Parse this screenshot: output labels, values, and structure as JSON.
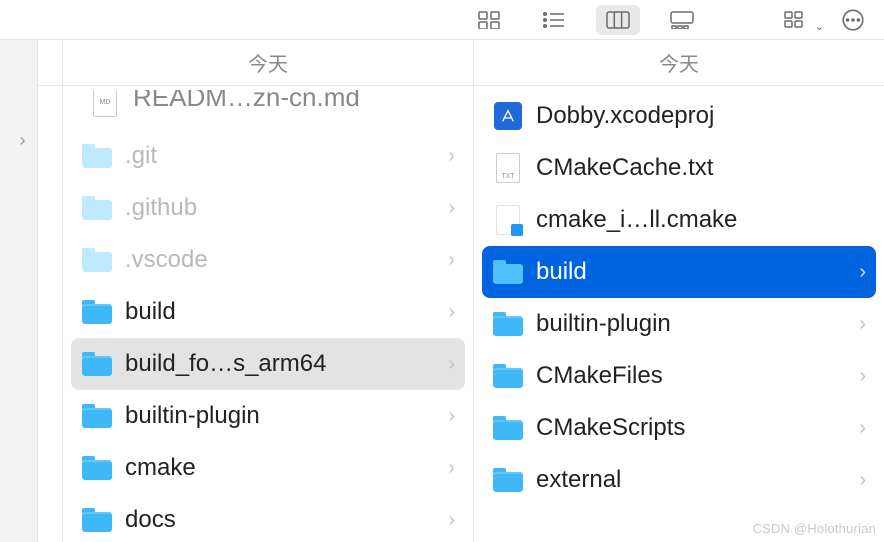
{
  "toolbar": {
    "icon_view": "grid-icon",
    "list_view": "list-icon",
    "column_view": "column-icon",
    "gallery_view": "gallery-icon",
    "group_view": "group-icon",
    "action_view": "action-icon"
  },
  "col1": {
    "header": ""
  },
  "col2": {
    "header": "今天",
    "partial_item": {
      "name": "READM…zn-cn.md",
      "icon": "md-file"
    },
    "items": [
      {
        "name": ".git",
        "icon": "folder-light",
        "has_children": true,
        "dim": true
      },
      {
        "name": ".github",
        "icon": "folder-light",
        "has_children": true,
        "dim": true
      },
      {
        "name": ".vscode",
        "icon": "folder-light",
        "has_children": true,
        "dim": true
      },
      {
        "name": "build",
        "icon": "folder-blue",
        "has_children": true
      },
      {
        "name": "build_fo…s_arm64",
        "icon": "folder-blue",
        "has_children": true,
        "selected": "grey"
      },
      {
        "name": "builtin-plugin",
        "icon": "folder-blue",
        "has_children": true
      },
      {
        "name": "cmake",
        "icon": "folder-blue",
        "has_children": true
      },
      {
        "name": "docs",
        "icon": "folder-blue",
        "has_children": true
      }
    ]
  },
  "col3": {
    "header": "今天",
    "items": [
      {
        "name": "Dobby.xcodeproj",
        "icon": "xcode"
      },
      {
        "name": "CMakeCache.txt",
        "icon": "txt"
      },
      {
        "name": "cmake_i…ll.cmake",
        "icon": "cmake"
      },
      {
        "name": "build",
        "icon": "folder-blue",
        "has_children": true,
        "selected": "blue"
      },
      {
        "name": "builtin-plugin",
        "icon": "folder-blue",
        "has_children": true
      },
      {
        "name": "CMakeFiles",
        "icon": "folder-blue",
        "has_children": true
      },
      {
        "name": "CMakeScripts",
        "icon": "folder-blue",
        "has_children": true
      },
      {
        "name": "external",
        "icon": "folder-blue",
        "has_children": true
      }
    ]
  },
  "watermark": "CSDN @Holothurian"
}
